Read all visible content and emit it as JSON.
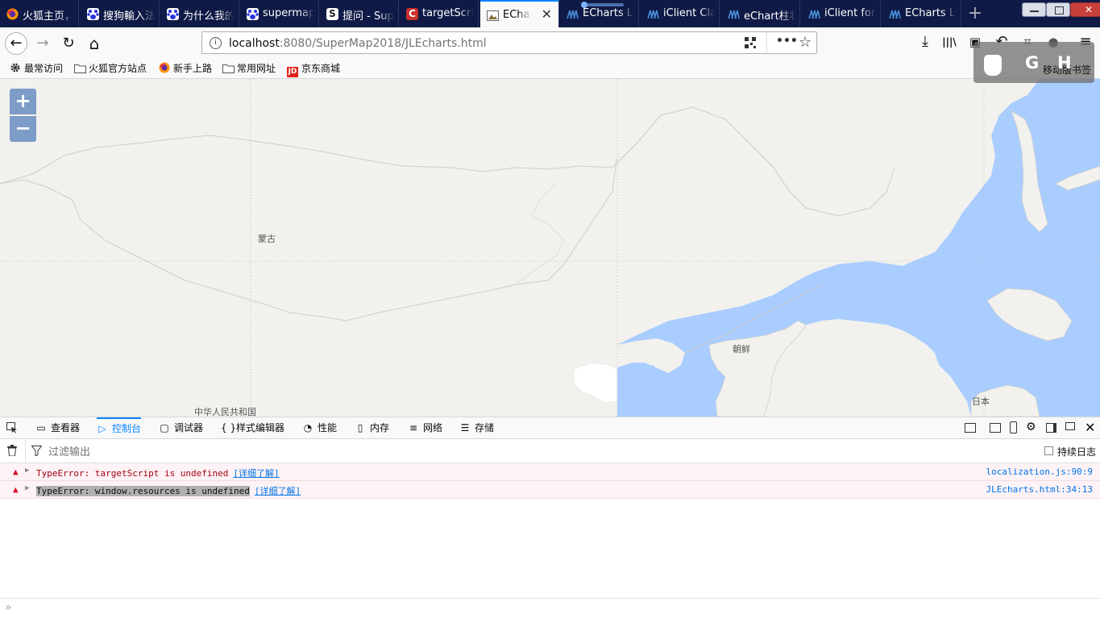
{
  "tabs": [
    {
      "label": "火狐主页，",
      "icon": "firefox-icon",
      "color": "#e66000"
    },
    {
      "label": "搜狗輸入法",
      "icon": "baidu-paw-icon",
      "color": "#2932e1"
    },
    {
      "label": "为什么我的",
      "icon": "baidu-paw-icon",
      "color": "#2932e1"
    },
    {
      "label": "supermap",
      "icon": "baidu-paw-icon",
      "color": "#2932e1"
    },
    {
      "label": "提问 - Sup",
      "icon": "s-icon",
      "color": "#222"
    },
    {
      "label": "targetScri",
      "icon": "csdn-icon",
      "color": "#c9302c"
    },
    {
      "label": "EChart",
      "icon": "image-icon",
      "color": "#999"
    },
    {
      "label": "ECharts Li",
      "icon": "wave-icon",
      "color": "#4a90d9"
    },
    {
      "label": "iClient Cla",
      "icon": "wave-icon",
      "color": "#4a90d9"
    },
    {
      "label": "eChart柱状",
      "icon": "wave-icon",
      "color": "#4a90d9"
    },
    {
      "label": "iClient for",
      "icon": "wave-icon",
      "color": "#4a90d9"
    },
    {
      "label": "ECharts Li",
      "icon": "wave-icon",
      "color": "#4a90d9"
    }
  ],
  "active_tab_index": 6,
  "new_tab_symbol": "+",
  "close_symbol": "✕",
  "nav": {
    "back": "←",
    "forward": "→",
    "reload": "↻",
    "home": "⌂",
    "url_host": "localhost",
    "url_path": ":8080/SuperMap2018/JLEcharts.html",
    "info": "i",
    "more": "•••",
    "star": "☆"
  },
  "toolbar_icons": {
    "download": "⤓",
    "library": "|||\\",
    "reader": "▣",
    "undo": "↶",
    "crop": "⌗",
    "chat": "●",
    "menu": "≡"
  },
  "bookmarks": [
    {
      "label": "最常访问",
      "icon": "gear-icon"
    },
    {
      "label": "火狐官方站点",
      "icon": "folder-icon"
    },
    {
      "label": "新手上路",
      "icon": "firefox-icon"
    },
    {
      "label": "常用网址",
      "icon": "folder-icon"
    },
    {
      "label": "京东商城",
      "icon": "jd-icon"
    }
  ],
  "extension_overlay": {
    "g_letter": "G",
    "h_letter": "H",
    "label": "移动版书签"
  },
  "map": {
    "zoom_in": "+",
    "zoom_out": "−",
    "labels": {
      "mongolia": "蒙古",
      "korea": "朝鲜",
      "china": "中华人民共和国",
      "japan": "日本"
    },
    "land_color": "#f2f1ee",
    "sea_color": "#a9cdff"
  },
  "devtools": {
    "tabs": [
      {
        "label": "查看器",
        "icon": "▭"
      },
      {
        "label": "控制台",
        "icon": "▷"
      },
      {
        "label": "调试器",
        "icon": "▢"
      },
      {
        "label": "样式编辑器",
        "icon": "{ }"
      },
      {
        "label": "性能",
        "icon": "◔"
      },
      {
        "label": "内存",
        "icon": "▯"
      },
      {
        "label": "网络",
        "icon": "≡"
      },
      {
        "label": "存储",
        "icon": "☰"
      }
    ],
    "active_tab_index": 1,
    "filter_placeholder": "过滤输出",
    "persist_logs": "持续日志",
    "messages": [
      {
        "text": "TypeError: targetScript is undefined",
        "link": "[详细了解]",
        "location": "localization.js:90:9"
      },
      {
        "text": "TypeError: window.resources is undefined",
        "link": "[详细了解]",
        "location": "JLEcharts.html:34:13"
      }
    ],
    "input_prompt": "»"
  }
}
